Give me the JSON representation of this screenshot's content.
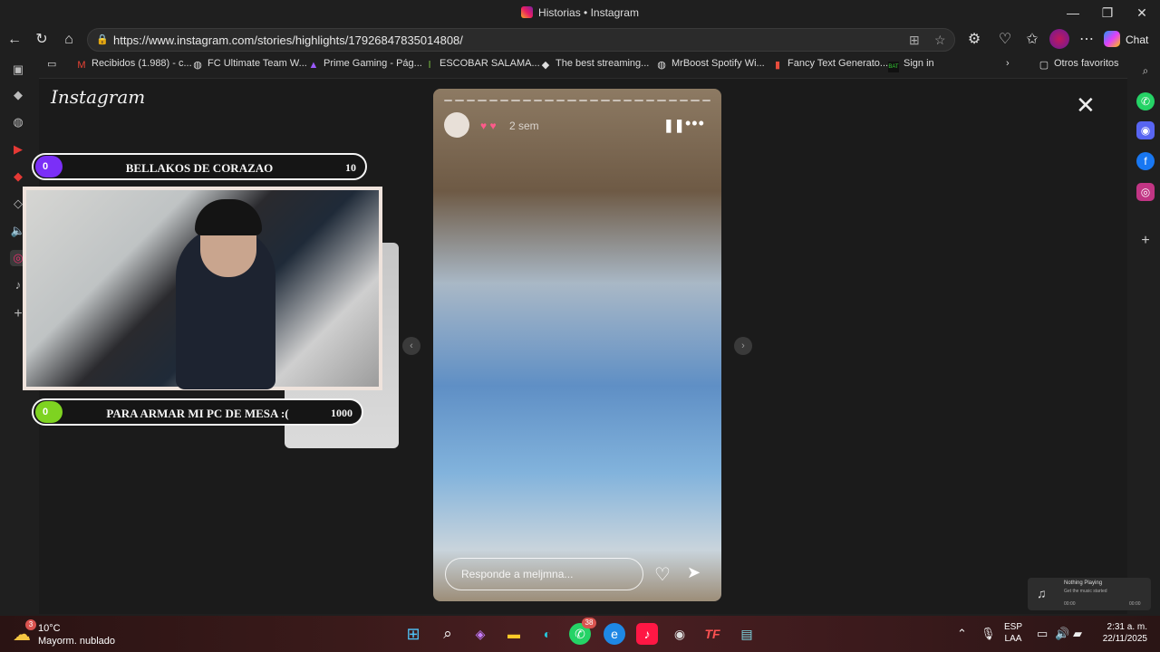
{
  "window": {
    "title": "Historias • Instagram"
  },
  "browser": {
    "url": "https://www.instagram.com/stories/highlights/17926847835014808/",
    "chat_label": "Chat"
  },
  "favorites": [
    {
      "label": "Recibidos (1.988) - c...",
      "icon": "gmail-icon"
    },
    {
      "label": "FC Ultimate Team W...",
      "icon": "globe-icon"
    },
    {
      "label": "Prime Gaming - Pág...",
      "icon": "prime-gaming-icon"
    },
    {
      "label": "ESCOBAR SALAMA...",
      "icon": "bookmark-icon"
    },
    {
      "label": "The best streaming...",
      "icon": "diamond-icon"
    },
    {
      "label": "MrBoost Spotify Wi...",
      "icon": "globe-icon"
    },
    {
      "label": "Fancy Text Generato...",
      "icon": "document-icon"
    },
    {
      "label": "Sign in",
      "icon": "bat-icon"
    },
    {
      "label": "Otros favoritos",
      "icon": "folder-icon"
    }
  ],
  "instagram": {
    "logo": "Instagram"
  },
  "story": {
    "username": "",
    "time": "2 sem",
    "reply_placeholder": "Responde a meljmna..."
  },
  "overlay": {
    "bar1": {
      "current": "0",
      "label": "BELLAKOS DE CORAZAO",
      "goal": "10",
      "color": "#7b2ff7"
    },
    "bar2": {
      "current": "0",
      "label": "PARA ARMAR MI PC DE MESA :(",
      "goal": "1000",
      "color": "#7ed321"
    }
  },
  "now_playing": {
    "title": "Nothing Playing",
    "subtitle": "Get the music started",
    "time_start": "00:00",
    "time_end": "00:00"
  },
  "taskbar": {
    "weather_temp": "10°C",
    "weather_cond": "Mayorm. nublado",
    "weather_badge": "3",
    "whatsapp_count": "38",
    "lang1": "ESP",
    "lang2": "LAA",
    "time": "2:31 a. m.",
    "date": "22/11/2025"
  }
}
